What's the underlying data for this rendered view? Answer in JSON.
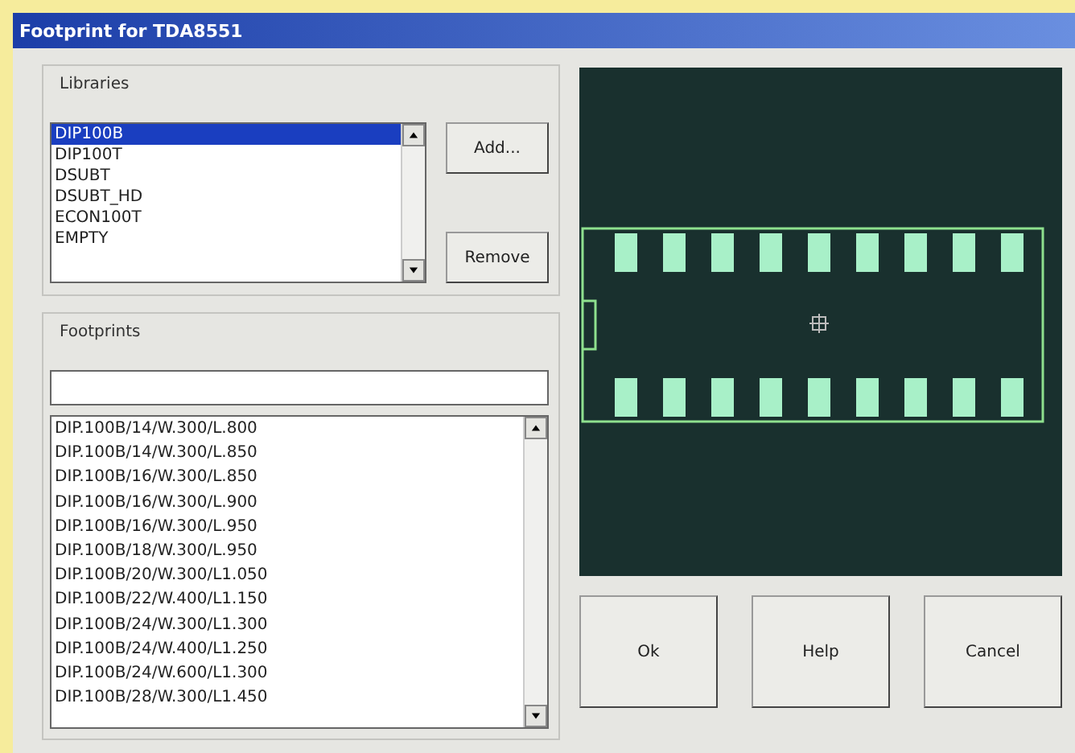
{
  "window": {
    "title": "Footprint for TDA8551"
  },
  "libraries": {
    "label": "Libraries",
    "items": [
      {
        "label": "DIP100B",
        "selected": true
      },
      {
        "label": "DIP100T",
        "selected": false
      },
      {
        "label": "DSUBT",
        "selected": false
      },
      {
        "label": "DSUBT_HD",
        "selected": false
      },
      {
        "label": "ECON100T",
        "selected": false
      },
      {
        "label": "EMPTY",
        "selected": false
      }
    ],
    "buttons": [
      "Add...",
      "Remove"
    ]
  },
  "footprints": {
    "label": "Footprints",
    "items": [
      "DIP.100B/14/W.300/L.800",
      "DIP.100B/14/W.300/L.850",
      "DIP.100B/16/W.300/L.850",
      "DIP.100B/16/W.300/L.900",
      "DIP.100B/16/W.300/L.950",
      "DIP.100B/18/W.300/L.950",
      "DIP.100B/20/W.300/L1.050",
      "DIP.100B/22/W.400/L1.150",
      "DIP.100B/24/W.300/L1.300",
      "DIP.100B/24/W.400/L1.250",
      "DIP.100B/24/W.600/L1.300",
      "DIP.100B/28/W.300/L1.450"
    ]
  },
  "buttons": [
    "Ok",
    "Help",
    "Cancel"
  ]
}
